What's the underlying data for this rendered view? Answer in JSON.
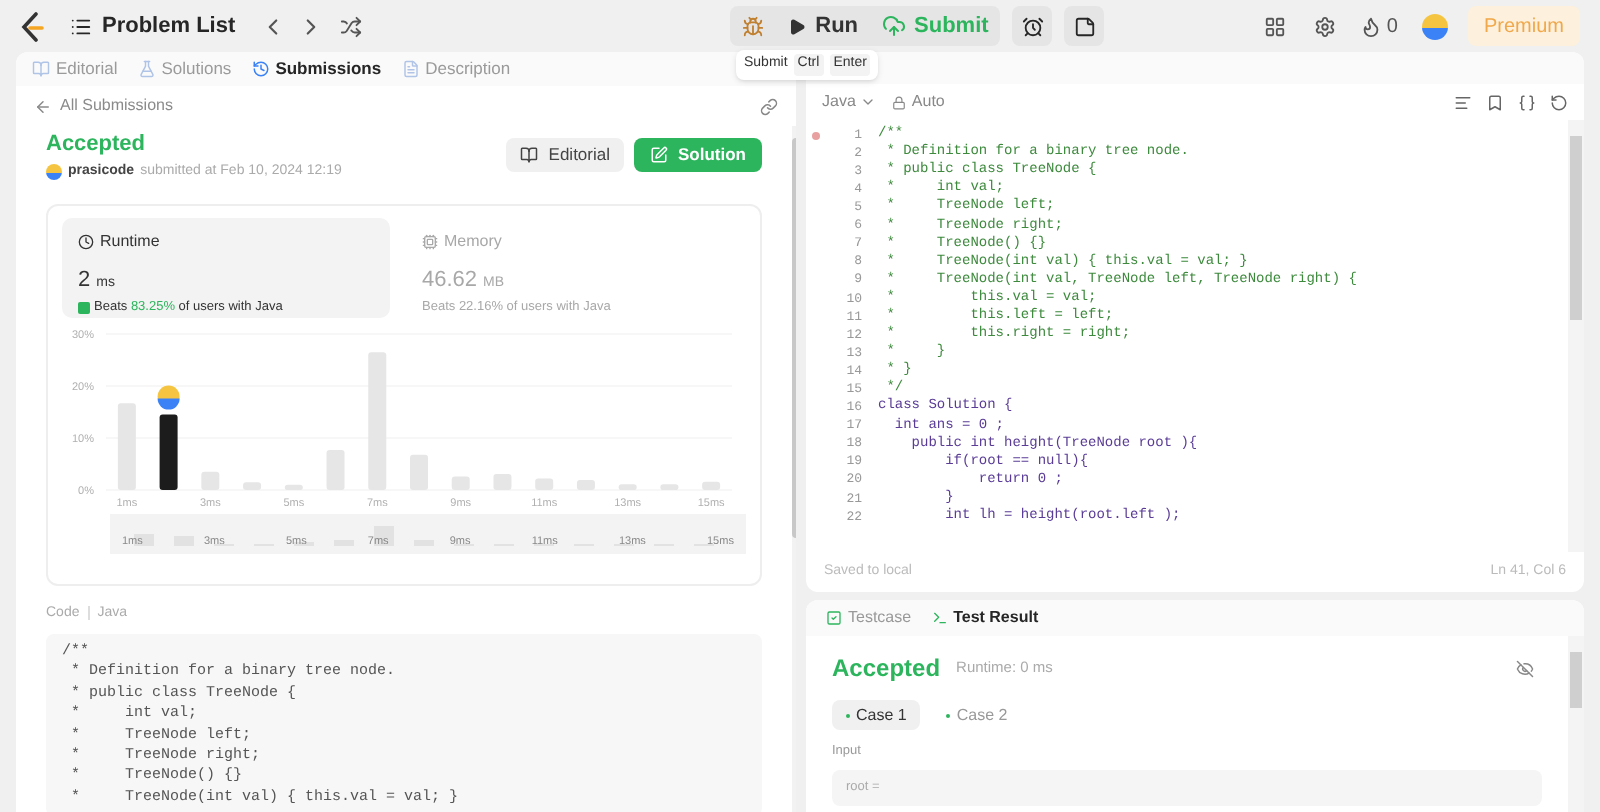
{
  "top_bar": {
    "title": "Problem List",
    "run": "Run",
    "submit": "Submit",
    "streak": "0",
    "premium": "Premium"
  },
  "tooltip": {
    "label": "Submit",
    "keys": [
      "Ctrl",
      "Enter"
    ]
  },
  "left_tabs": [
    {
      "label": "Editorial",
      "selected": false
    },
    {
      "label": "Solutions",
      "selected": false
    },
    {
      "label": "Submissions",
      "selected": true
    },
    {
      "label": "Description",
      "selected": false
    }
  ],
  "back_link": "All Submissions",
  "submission": {
    "status": "Accepted",
    "user": "prasicode",
    "submitted": "submitted at Feb 10, 2024 12:19",
    "editorial": "Editorial",
    "solution": "Solution"
  },
  "metrics": [
    {
      "label": "Runtime",
      "value": "2",
      "unit": "ms",
      "beats": "Beats",
      "pct": "83.25%",
      "suffix": "of users with Java",
      "selected": true
    },
    {
      "label": "Memory",
      "value": "46.62",
      "unit": "MB",
      "beats": "Beats",
      "pct": "22.16%",
      "suffix": "of users with Java",
      "selected": false
    }
  ],
  "chart_data": {
    "type": "bar",
    "x": [
      1,
      2,
      3,
      4,
      5,
      6,
      7,
      8,
      9,
      10,
      11,
      12,
      13,
      14,
      15
    ],
    "xlim": [
      0.5,
      15.5
    ],
    "xticks": [
      {
        "value": 1,
        "label": "1ms"
      },
      {
        "value": 3,
        "label": "3ms"
      },
      {
        "value": 5,
        "label": "5ms"
      },
      {
        "value": 7,
        "label": "7ms"
      },
      {
        "value": 9,
        "label": "9ms"
      },
      {
        "value": 11,
        "label": "11ms"
      },
      {
        "value": 13,
        "label": "13ms"
      },
      {
        "value": 15,
        "label": "15ms"
      }
    ],
    "ylim": [
      0,
      30
    ],
    "yticks": [
      {
        "value": 0,
        "label": "0%"
      },
      {
        "value": 10,
        "label": "10%"
      },
      {
        "value": 20,
        "label": "20%"
      },
      {
        "value": 30,
        "label": "30%"
      }
    ],
    "values": [
      16.7,
      14.5,
      3.5,
      1.5,
      1,
      7.7,
      26.5,
      6.8,
      2.6,
      3.1,
      2.2,
      1.9,
      1.1,
      1.1,
      1.6
    ]
  },
  "navigator_labels": [
    "1ms",
    "3ms",
    "5ms",
    "7ms",
    "9ms",
    "11ms",
    "13ms",
    "15ms"
  ],
  "code_section": {
    "label": "Code",
    "language": "Java",
    "lines": [
      "/**",
      " * Definition for a binary tree node.",
      " * public class TreeNode {",
      " *     int val;",
      " *     TreeNode left;",
      " *     TreeNode right;",
      " *     TreeNode() {}",
      " *     TreeNode(int val) { this.val = val; }"
    ]
  },
  "editor": {
    "language": "Java",
    "mode": "Auto",
    "saved": "Saved to local",
    "cursor": "Ln 41, Col 6",
    "lines": [
      {
        "n": "1",
        "text": "/**",
        "kind": "comment"
      },
      {
        "n": "2",
        "text": " * Definition for a binary tree node.",
        "kind": "comment"
      },
      {
        "n": "3",
        "text": " * public class TreeNode {",
        "kind": "comment"
      },
      {
        "n": "4",
        "text": " *     int val;",
        "kind": "comment"
      },
      {
        "n": "5",
        "text": " *     TreeNode left;",
        "kind": "comment"
      },
      {
        "n": "6",
        "text": " *     TreeNode right;",
        "kind": "comment"
      },
      {
        "n": "7",
        "text": " *     TreeNode() {}",
        "kind": "comment"
      },
      {
        "n": "8",
        "text": " *     TreeNode(int val) { this.val = val; }",
        "kind": "comment"
      },
      {
        "n": "9",
        "text": " *     TreeNode(int val, TreeNode left, TreeNode right) {",
        "kind": "comment"
      },
      {
        "n": "10",
        "text": " *         this.val = val;",
        "kind": "comment"
      },
      {
        "n": "11",
        "text": " *         this.left = left;",
        "kind": "comment"
      },
      {
        "n": "12",
        "text": " *         this.right = right;",
        "kind": "comment"
      },
      {
        "n": "13",
        "text": " *     }",
        "kind": "comment"
      },
      {
        "n": "14",
        "text": " * }",
        "kind": "comment"
      },
      {
        "n": "15",
        "text": " */",
        "kind": "comment"
      },
      {
        "n": "16",
        "text": "class Solution {",
        "kind": "code"
      },
      {
        "n": "17",
        "text": "  int ans = 0 ;",
        "kind": "code"
      },
      {
        "n": "18",
        "text": "    public int height(TreeNode root ){",
        "kind": "code"
      },
      {
        "n": "19",
        "text": "        if(root == null){",
        "kind": "code"
      },
      {
        "n": "20",
        "text": "            return 0 ;",
        "kind": "code"
      },
      {
        "n": "21",
        "text": "        }",
        "kind": "code"
      },
      {
        "n": "22",
        "text": "        int lh = height(root.left );",
        "kind": "code"
      }
    ]
  },
  "result_tabs": [
    {
      "label": "Testcase",
      "selected": false
    },
    {
      "label": "Test Result",
      "selected": true
    }
  ],
  "result": {
    "status": "Accepted",
    "runtime": "Runtime: 0 ms",
    "cases": [
      {
        "label": "Case 1",
        "selected": true
      },
      {
        "label": "Case 2",
        "selected": false
      }
    ],
    "input_label": "Input",
    "input_value": "root ="
  }
}
